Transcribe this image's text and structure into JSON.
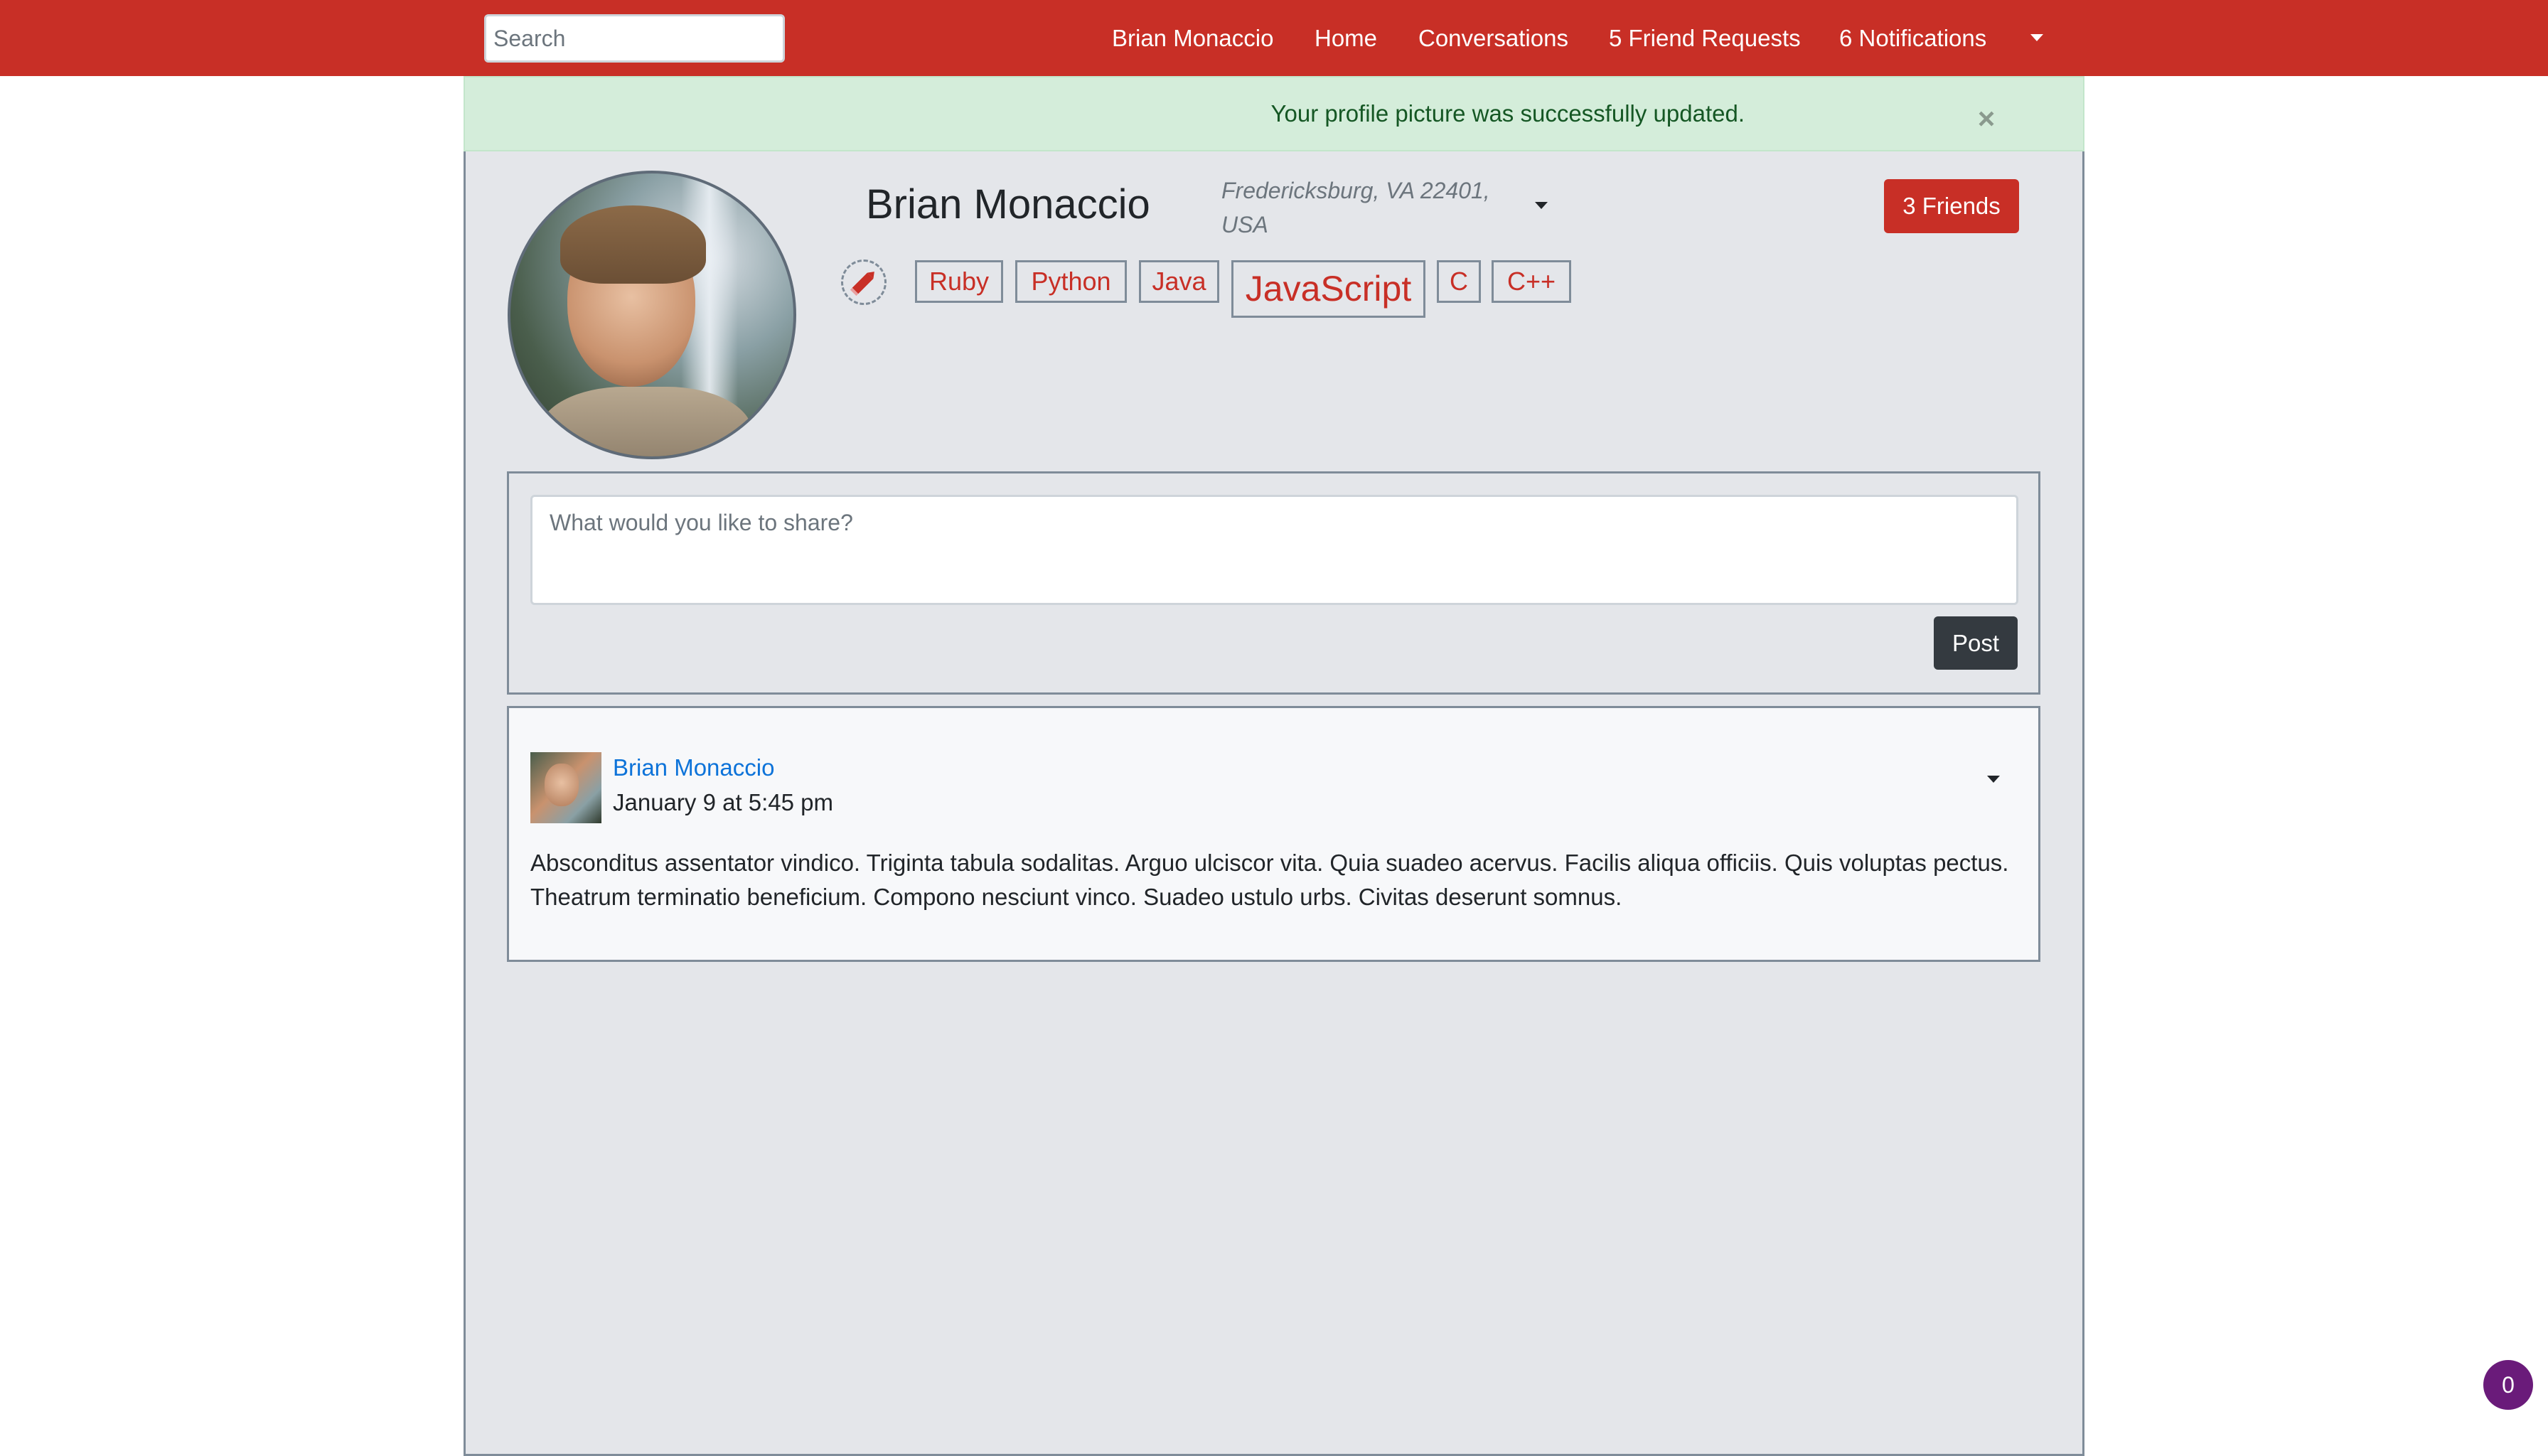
{
  "navbar": {
    "search_placeholder": "Search",
    "links": {
      "profile": "Brian Monaccio",
      "home": "Home",
      "conversations": "Conversations",
      "friend_requests": "5 Friend Requests",
      "notifications": "6 Notifications"
    }
  },
  "alert": {
    "message": "Your profile picture was successfully updated.",
    "close": "×"
  },
  "profile": {
    "name": "Brian Monaccio",
    "location": "Fredericksburg, VA 22401, USA",
    "friends_button": "3 Friends",
    "tags": [
      "Ruby",
      "Python",
      "Java",
      "JavaScript",
      "C",
      "C++"
    ]
  },
  "composer": {
    "placeholder": "What would you like to share?",
    "post_button": "Post"
  },
  "post": {
    "author": "Brian Monaccio",
    "time": "January 9 at 5:45 pm",
    "body": "Absconditus assentator vindico. Triginta tabula sodalitas. Arguo ulciscor vita. Quia suadeo acervus. Facilis aliqua officiis. Quis voluptas pectus. Theatrum terminatio beneficium. Compono nesciunt vinco. Suadeo ustulo urbs. Civitas deserunt somnus."
  },
  "fab": {
    "count": "0"
  },
  "colors": {
    "brand_red": "#c82f26",
    "alert_green_bg": "#d4edda",
    "alert_green_text": "#155724",
    "page_gray": "#e4e6ea",
    "dark_button": "#343a40",
    "link_blue": "#0d73d9",
    "fab_purple": "#6a1b7a"
  },
  "icons": {
    "edit": "pencil-icon",
    "close": "close-icon",
    "caret": "caret-down-icon"
  }
}
